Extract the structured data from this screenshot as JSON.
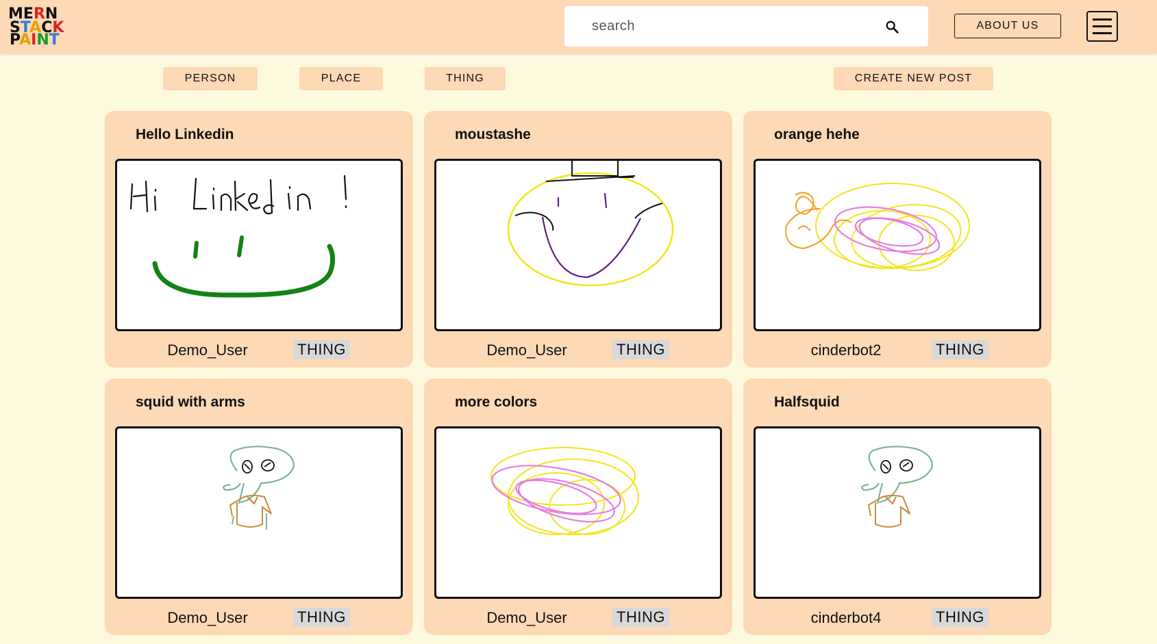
{
  "header": {
    "logo_text": [
      "MERN",
      "STACK",
      "PAINT"
    ],
    "search_placeholder": "search",
    "about_label": "ABOUT US"
  },
  "filters": {
    "person": "PERSON",
    "place": "PLACE",
    "thing": "THING",
    "create": "CREATE NEW POST"
  },
  "posts": [
    {
      "title": "Hello Linkedin",
      "author": "Demo_User",
      "category": "THING"
    },
    {
      "title": "moustashe",
      "author": "Demo_User",
      "category": "THING"
    },
    {
      "title": "orange hehe",
      "author": "cinderbot2",
      "category": "THING"
    },
    {
      "title": "squid with arms",
      "author": "Demo_User",
      "category": "THING"
    },
    {
      "title": "more colors",
      "author": "Demo_User",
      "category": "THING"
    },
    {
      "title": "Halfsquid",
      "author": "cinderbot4",
      "category": "THING"
    }
  ],
  "colors": {
    "header_bg": "#fdd9b5",
    "page_bg": "#fdf9dc",
    "card_bg": "#fdd9b5",
    "tag_bg": "#d8d8d8"
  }
}
